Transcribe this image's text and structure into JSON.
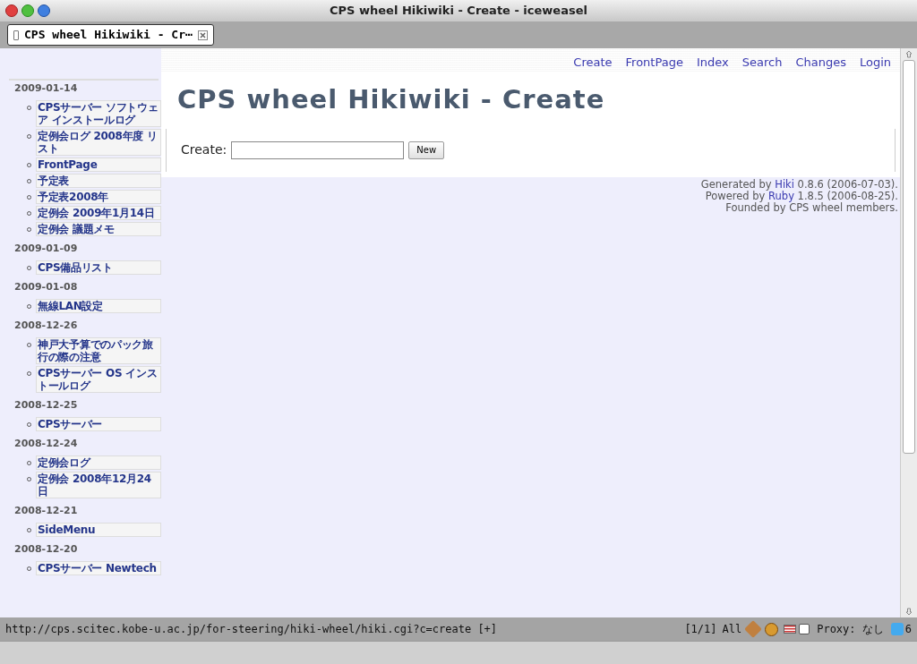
{
  "window": {
    "title": "CPS wheel Hikiwiki - Create - iceweasel"
  },
  "tab": {
    "label": "CPS wheel Hikiwiki - Cr⋯"
  },
  "nav": [
    "Create",
    "FrontPage",
    "Index",
    "Search",
    "Changes",
    "Login"
  ],
  "page": {
    "title": "CPS wheel Hikiwiki - Create",
    "create_label": "Create:",
    "button": "New"
  },
  "footer": [
    {
      "before": "Generated by ",
      "link": "Hiki",
      "after": " 0.8.6 (2006-07-03)."
    },
    {
      "before": "Powered by ",
      "link": "Ruby",
      "after": " 1.8.5 (2006-08-25)."
    },
    {
      "before": "Founded by CPS wheel members."
    }
  ],
  "sidebar": [
    {
      "date": "2009-01-14",
      "items": [
        "CPSサーバー ソフトウェア インストールログ",
        "定例会ログ 2008年度 リスト",
        "FrontPage",
        "予定表",
        "予定表2008年",
        "定例会 2009年1月14日",
        "定例会 議題メモ"
      ]
    },
    {
      "date": "2009-01-09",
      "items": [
        "CPS備品リスト"
      ]
    },
    {
      "date": "2009-01-08",
      "items": [
        "無線LAN設定"
      ]
    },
    {
      "date": "2008-12-26",
      "items": [
        "神戸大予算でのパック旅行の際の注意",
        "CPSサーバー OS インストールログ"
      ]
    },
    {
      "date": "2008-12-25",
      "items": [
        "CPSサーバー"
      ]
    },
    {
      "date": "2008-12-24",
      "items": [
        "定例会ログ",
        "定例会 2008年12月24日"
      ]
    },
    {
      "date": "2008-12-21",
      "items": [
        "SideMenu"
      ]
    },
    {
      "date": "2008-12-20",
      "items": [
        "CPSサーバー Newtech"
      ]
    }
  ],
  "status_bar": {
    "url": "http://cps.scitec.kobe-u.ac.jp/for-steering/hiki-wheel/hiki.cgi?c=create [+]",
    "page_count": "[1/1]",
    "mode": "All",
    "proxy": "Proxy: なし",
    "count": "6"
  }
}
